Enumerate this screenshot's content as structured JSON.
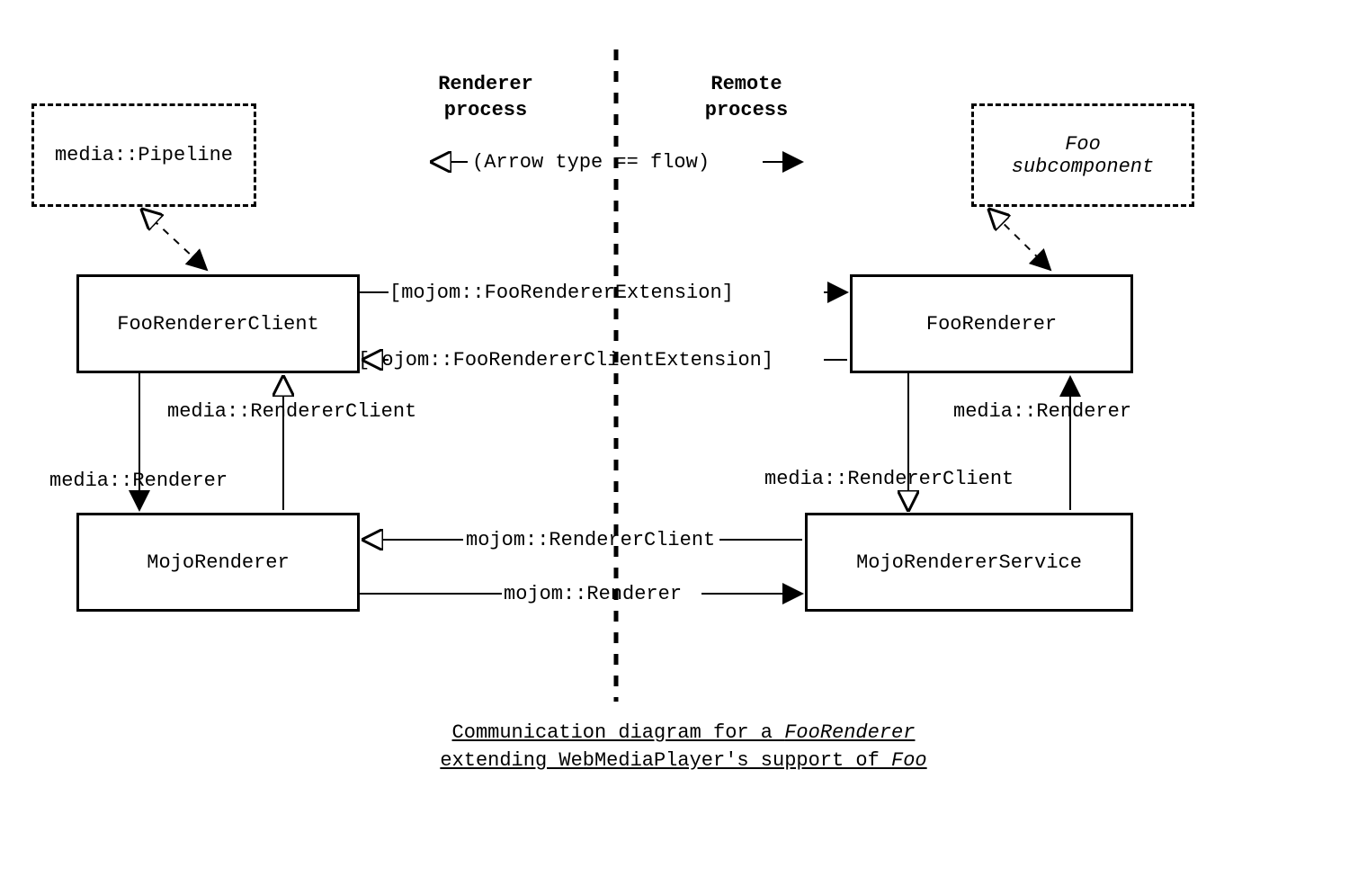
{
  "titles": {
    "left": "Renderer\nprocess",
    "right": "Remote\nprocess"
  },
  "legend": "(Arrow type == flow)",
  "boxes": {
    "pipeline": "media::Pipeline",
    "fooSubcomponent_line1": "Foo",
    "fooSubcomponent_line2": "subcomponent",
    "fooRendererClient": "FooRendererClient",
    "fooRenderer": "FooRenderer",
    "mojoRenderer": "MojoRenderer",
    "mojoRendererService": "MojoRendererService"
  },
  "labels": {
    "extTop": "[mojom::FooRendererExtension]",
    "extBot": "[mojom::FooRendererClientExtension]",
    "rcLeft": "media::RendererClient",
    "rLeft": "media::Renderer",
    "rcRight": "media::RendererClient",
    "rRight": "media::Renderer",
    "mojomRC": "mojom::RendererClient",
    "mojomR": "mojom::Renderer"
  },
  "caption_line1_pre": "Communication diagram for a ",
  "caption_line1_em": "FooRenderer",
  "caption_line2_pre": "extending WebMediaPlayer's support of ",
  "caption_line2_em": "Foo"
}
